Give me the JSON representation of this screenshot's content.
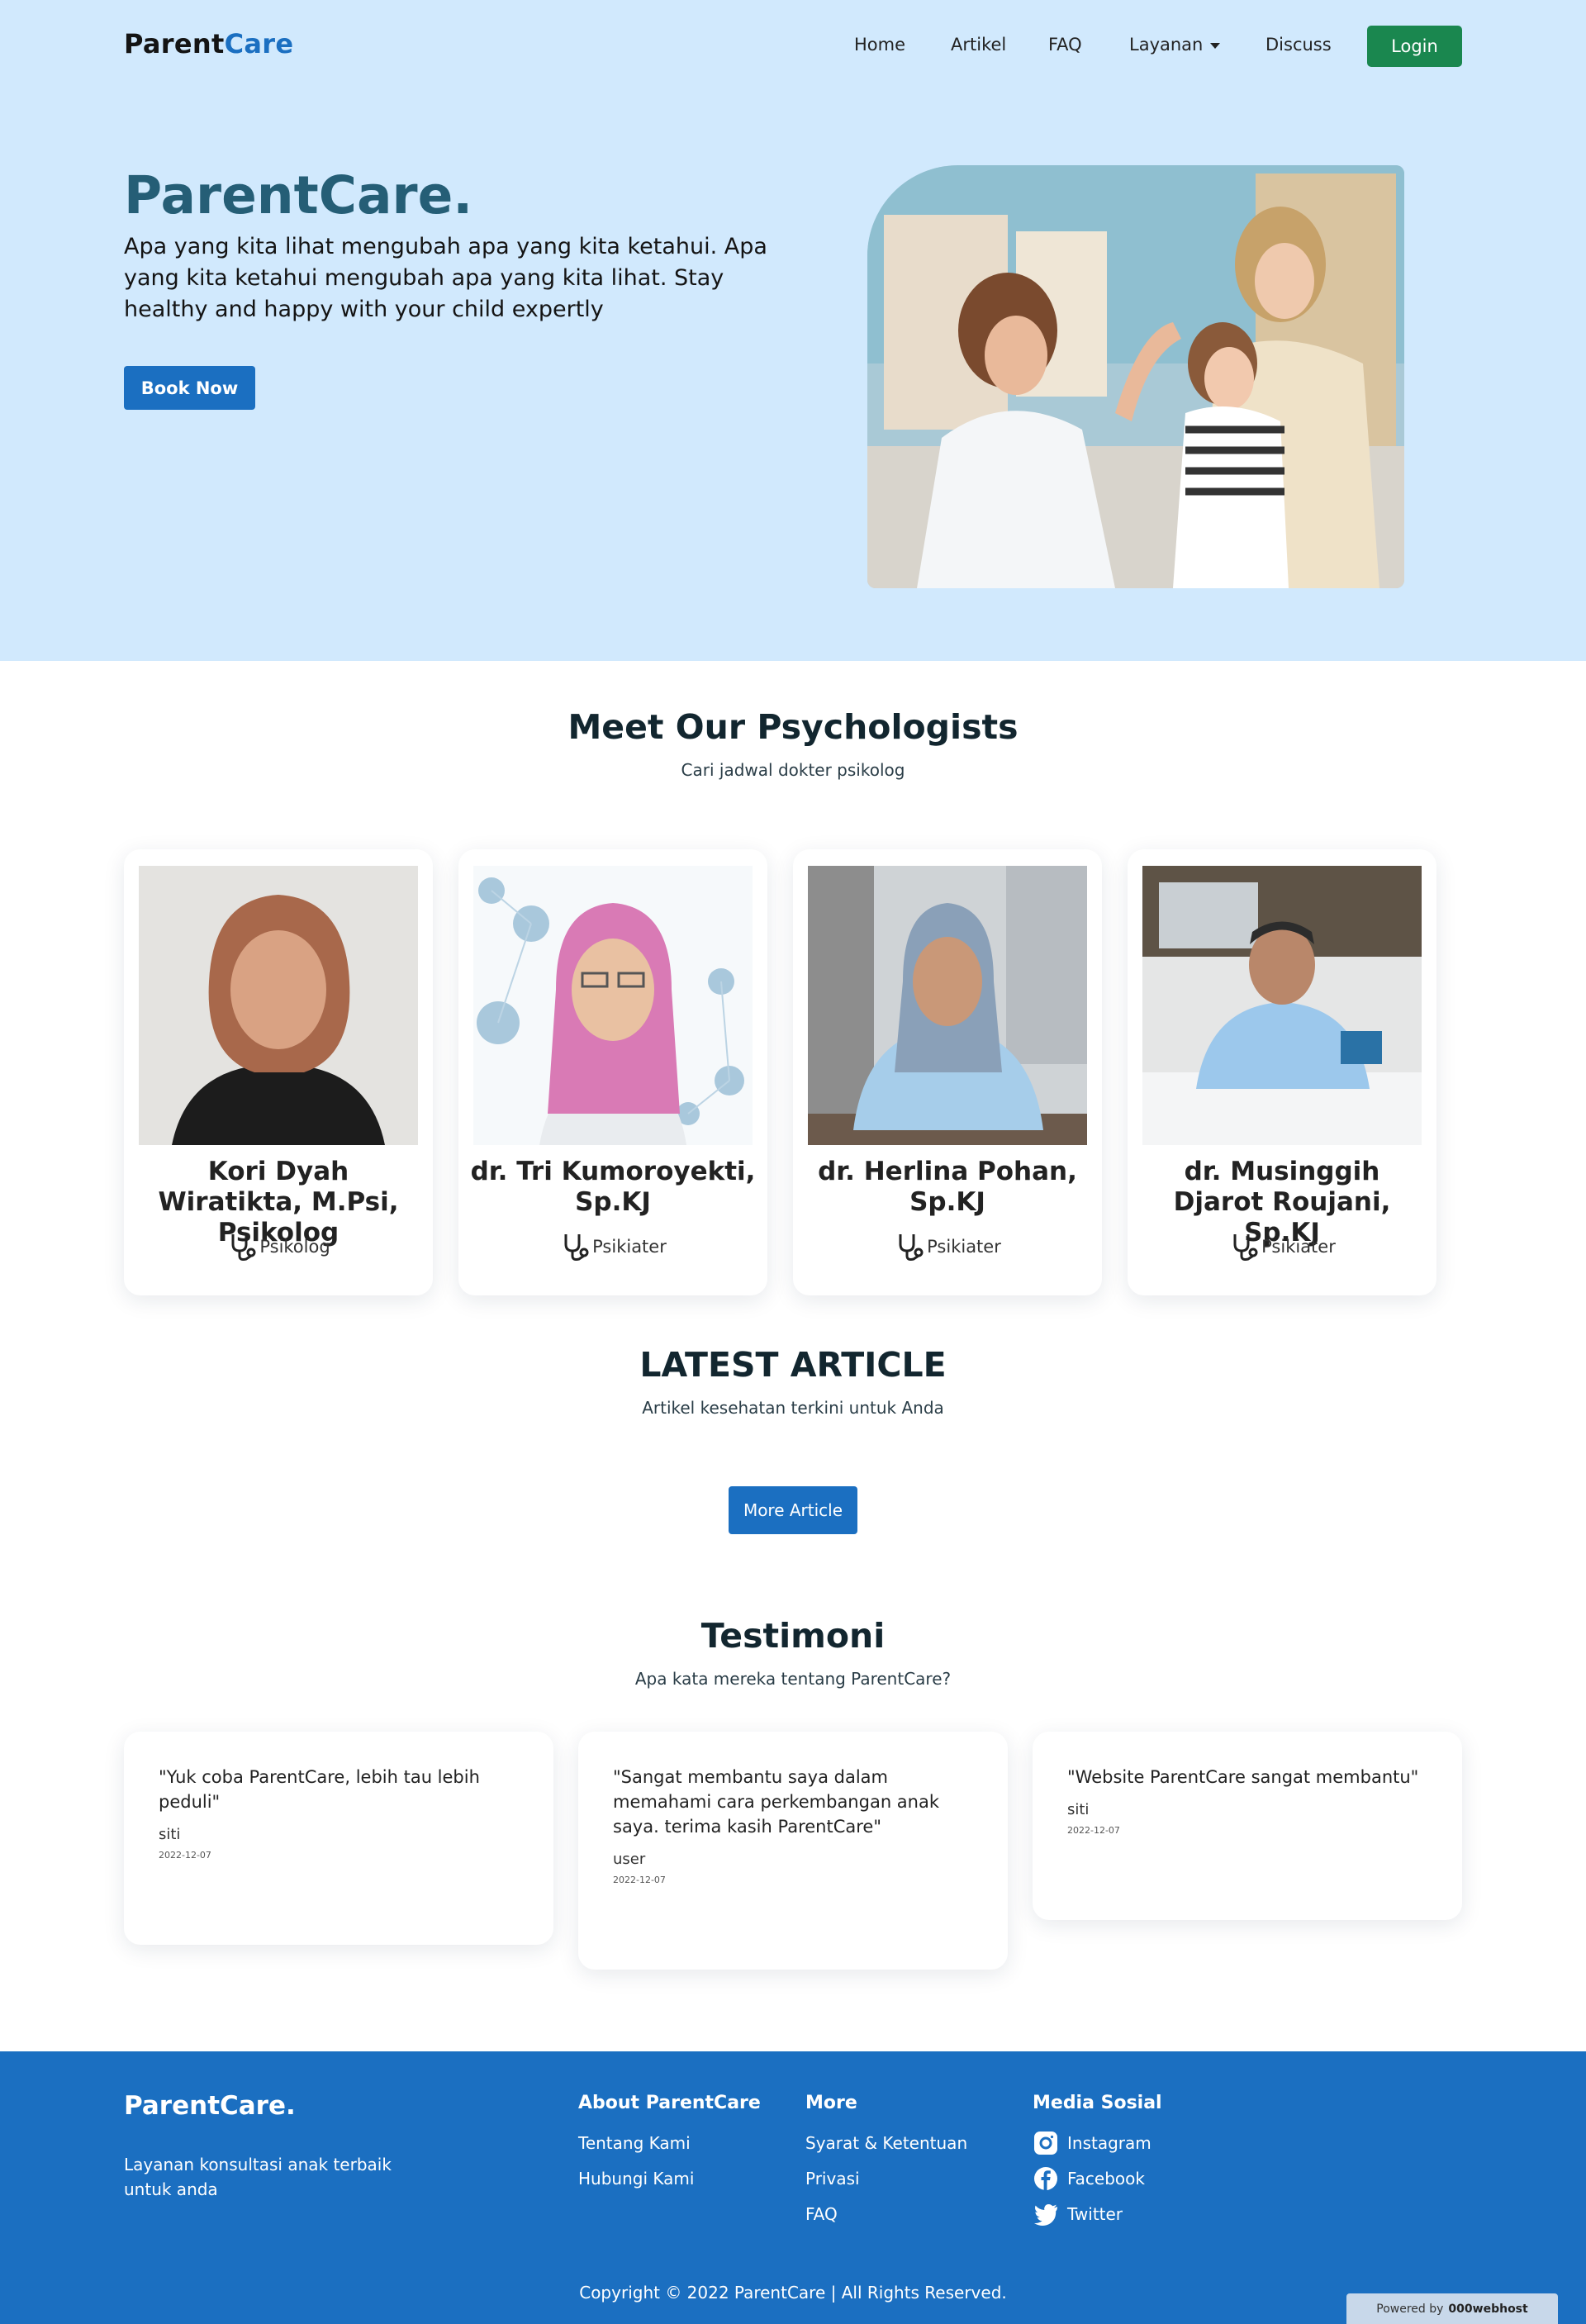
{
  "navbar": {
    "brand_parent": "Parent",
    "brand_care": "Care",
    "links": [
      {
        "label": "Home"
      },
      {
        "label": "Artikel"
      },
      {
        "label": "FAQ"
      },
      {
        "label": "Layanan"
      },
      {
        "label": "Discuss"
      }
    ],
    "login_label": "Login"
  },
  "hero": {
    "title": "ParentCare.",
    "text": "Apa yang kita lihat mengubah apa yang kita ketahui. Apa yang kita ketahui mengubah apa yang kita lihat. Stay healthy and happy with your child expertly",
    "button_label": "Book Now"
  },
  "psychologists": {
    "title": "Meet Our Psychologists",
    "subtitle": "Cari jadwal dokter psikolog",
    "doctors": [
      {
        "name": "Kori Dyah Wiratikta, M.Psi, Psikolog",
        "role": "Psikolog"
      },
      {
        "name": "dr. Tri Kumoroyekti, Sp.KJ",
        "role": "Psikiater"
      },
      {
        "name": "dr. Herlina Pohan, Sp.KJ",
        "role": "Psikiater"
      },
      {
        "name": "dr. Musinggih Djarot Roujani, Sp.KJ",
        "role": "Psikiater"
      }
    ]
  },
  "articles": {
    "title": "LATEST ARTICLE",
    "subtitle": "Artikel kesehatan terkini untuk Anda",
    "button_label": "More Article"
  },
  "testimonials": {
    "title": "Testimoni",
    "subtitle": "Apa kata mereka tentang ParentCare?",
    "items": [
      {
        "quote": "\"Yuk coba ParentCare, lebih tau lebih peduli\"",
        "user": "siti",
        "date": "2022-12-07"
      },
      {
        "quote": "\"Sangat membantu saya dalam memahami cara perkembangan anak saya. terima kasih ParentCare\"",
        "user": "user",
        "date": "2022-12-07"
      },
      {
        "quote": "\"Website ParentCare sangat membantu\"",
        "user": "siti",
        "date": "2022-12-07"
      }
    ]
  },
  "footer": {
    "brand": "ParentCare.",
    "description": "Layanan konsultasi anak terbaik untuk anda",
    "about": {
      "title": "About ParentCare",
      "links": [
        "Tentang Kami",
        "Hubungi Kami"
      ]
    },
    "more": {
      "title": "More",
      "links": [
        "Syarat & Ketentuan",
        "Privasi",
        "FAQ"
      ]
    },
    "social": {
      "title": "Media Sosial",
      "links": [
        {
          "label": "Instagram",
          "icon": "instagram-icon"
        },
        {
          "label": "Facebook",
          "icon": "facebook-icon"
        },
        {
          "label": "Twitter",
          "icon": "twitter-icon"
        }
      ]
    },
    "copyright": "Copyright © 2022 ParentCare | All Rights Reserved.",
    "powered_by": "Powered by",
    "host": "000webhost"
  },
  "colors": {
    "hero_bg": "#d1e9fd",
    "primary": "#1b6fc1",
    "login": "#1a874f",
    "title": "#255e76"
  }
}
